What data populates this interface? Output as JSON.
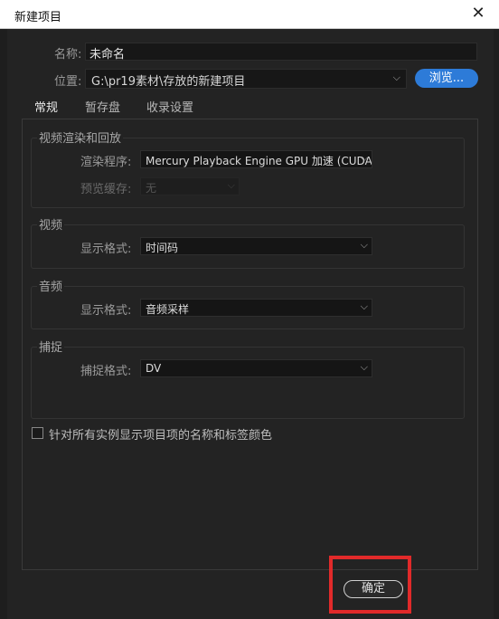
{
  "window": {
    "title": "新建项目",
    "close_glyph": "✕"
  },
  "name": {
    "label": "名称:",
    "value": "未命名"
  },
  "location": {
    "label": "位置:",
    "value": "G:\\pr19素材\\存放的新建项目",
    "browse_label": "浏览..."
  },
  "tabs": [
    {
      "label": "常规",
      "active": true
    },
    {
      "label": "暂存盘",
      "active": false
    },
    {
      "label": "收录设置",
      "active": false
    }
  ],
  "render": {
    "title": "视频渲染和回放",
    "renderer_label": "渲染程序:",
    "renderer_value": "Mercury Playback Engine GPU 加速 (CUDA)",
    "preview_cache_label": "预览缓存:",
    "preview_cache_value": "无"
  },
  "video": {
    "title": "视频",
    "format_label": "显示格式:",
    "format_value": "时间码"
  },
  "audio": {
    "title": "音频",
    "format_label": "显示格式:",
    "format_value": "音频采样"
  },
  "capture": {
    "title": "捕捉",
    "format_label": "捕捉格式:",
    "format_value": "DV"
  },
  "checkbox": {
    "label": "针对所有实例显示项目项的名称和标签颜色",
    "checked": false
  },
  "footer": {
    "ok_label": "确定"
  },
  "colors": {
    "accent": "#2d7bd8",
    "highlight": "#e12a2a"
  }
}
